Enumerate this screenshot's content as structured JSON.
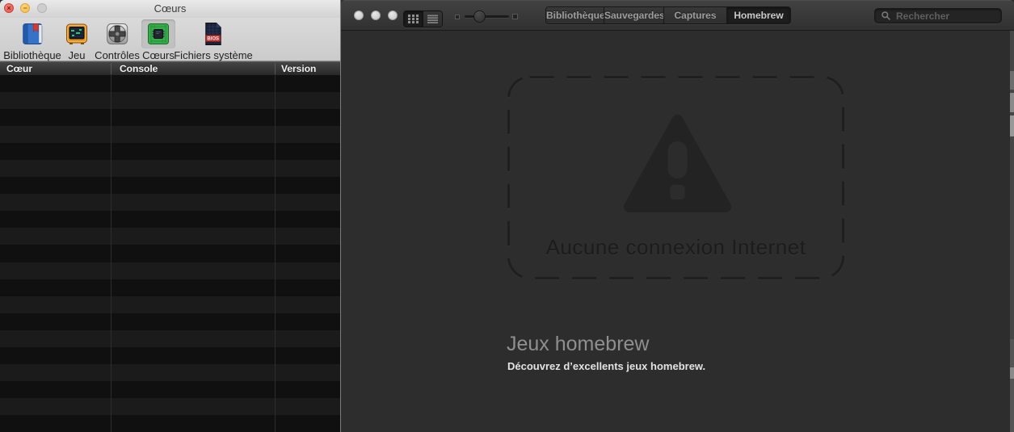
{
  "left_window": {
    "title": "Cœurs",
    "window_controls": {
      "close_glyph": "×",
      "minimize_glyph": "−"
    },
    "toolbar": {
      "items": [
        {
          "label": "Bibliothèque"
        },
        {
          "label": "Jeu"
        },
        {
          "label": "Contrôles"
        },
        {
          "label": "Cœurs"
        },
        {
          "label": "Fichiers système"
        }
      ],
      "selected_item": "Cœurs",
      "bios_icon_text": "BIOS"
    },
    "table": {
      "columns": [
        "Cœur",
        "Console",
        "Version"
      ],
      "rows": [],
      "visible_row_count": 21
    }
  },
  "right_window": {
    "toolbar": {
      "view_modes": [
        {
          "name": "grid",
          "selected": true
        },
        {
          "name": "list",
          "selected": false
        }
      ],
      "zoom_slider": {
        "value_percent": 34
      },
      "tabs": [
        {
          "label": "Bibliothèque",
          "selected": false
        },
        {
          "label": "Sauvegardes",
          "selected": false
        },
        {
          "label": "Captures",
          "selected": false
        },
        {
          "label": "Homebrew",
          "selected": true
        }
      ],
      "search": {
        "placeholder": "Rechercher",
        "value": ""
      }
    },
    "content": {
      "offline_message": "Aucune connexion Internet",
      "section_heading": "Jeux homebrew",
      "section_subheading": "Découvrez d’excellents jeux homebrew."
    }
  },
  "colors": {
    "right_titlebar": "#3a3a3a",
    "right_content_bg": "#2d2d2d",
    "left_toolbar_bg": "#d4d4d4",
    "table_header_bg": "#303030",
    "table_row_dark": "#101010",
    "table_row_light": "#1b1b1b",
    "selected_segment_bg": "#1e1e1e",
    "warning_shape": "#232323",
    "traffic_red": "#ee6a5f",
    "traffic_yellow": "#f6be50",
    "traffic_gray": "#cfcfcf"
  }
}
